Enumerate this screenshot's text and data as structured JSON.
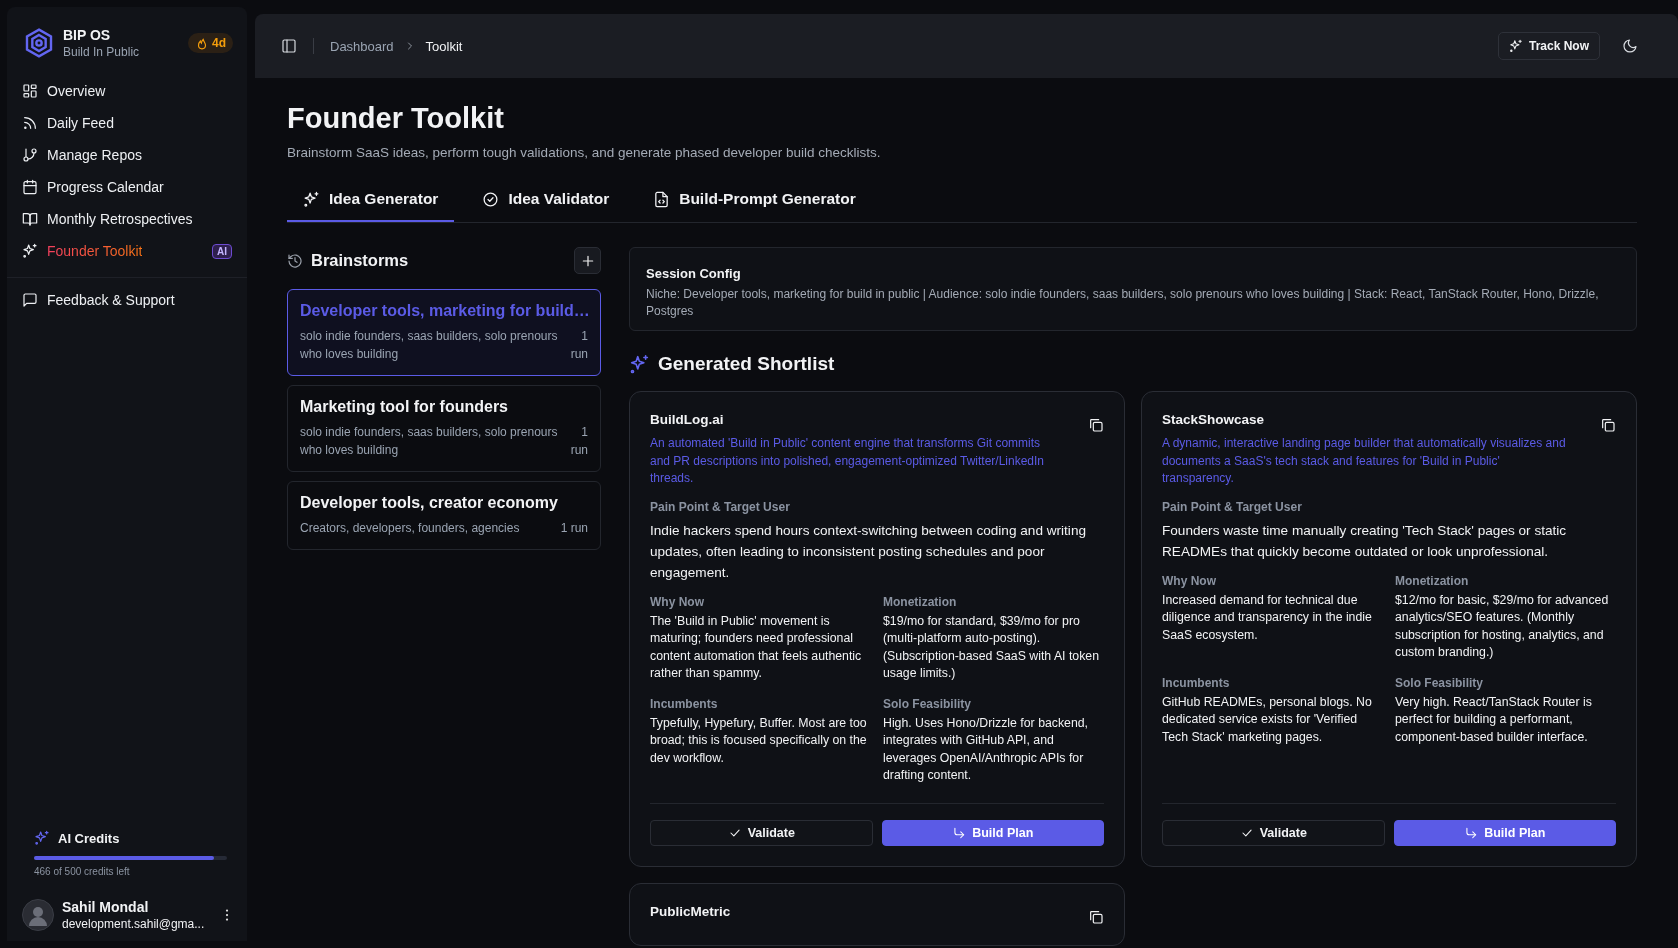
{
  "sidebar": {
    "brand": {
      "name": "BIP OS",
      "tagline": "Build In Public"
    },
    "streak": "4d",
    "nav": [
      {
        "label": "Overview",
        "selected": false
      },
      {
        "label": "Daily Feed",
        "selected": false
      },
      {
        "label": "Manage Repos",
        "selected": false
      },
      {
        "label": "Progress Calendar",
        "selected": false
      },
      {
        "label": "Monthly Retrospectives",
        "selected": false
      },
      {
        "label": "Founder Toolkit",
        "selected": true,
        "badge": "AI"
      }
    ],
    "footer_nav": [
      {
        "label": "Feedback & Support",
        "selected": false
      }
    ],
    "credits": {
      "title": "AI Credits",
      "level": 0.932,
      "caption": "466 of 500 credits left"
    },
    "user": {
      "name": "Sahil Mondal",
      "email": "development.sahil@gma..."
    }
  },
  "header": {
    "breadcrumb": [
      "Dashboard",
      "Toolkit"
    ],
    "action": "Track Now"
  },
  "page": {
    "title": "Founder Toolkit",
    "subtitle": "Brainstorm SaaS ideas, perform tough validations, and generate phased developer build checklists."
  },
  "tabs": [
    {
      "label": "Idea Generator",
      "selected": true
    },
    {
      "label": "Idea Validator",
      "selected": false
    },
    {
      "label": "Build-Prompt Generator",
      "selected": false
    }
  ],
  "brainstorms": {
    "title": "Brainstorms",
    "items": [
      {
        "title": "Developer tools, marketing for build…",
        "audience": "solo indie founders, saas builders, solo prenours who loves building",
        "runs": "1 run",
        "selected": true
      },
      {
        "title": "Marketing tool for founders",
        "audience": "solo indie founders, saas builders, solo prenours who loves building",
        "runs": "1 run",
        "selected": false
      },
      {
        "title": "Developer tools, creator economy",
        "audience": "Creators, developers, founders, agencies",
        "runs": "1 run",
        "selected": false
      }
    ]
  },
  "session_config": {
    "title": "Session Config",
    "text": "Niche: Developer tools, marketing for build in public | Audience: solo indie founders, saas builders, solo prenours who loves building | Stack: React, TanStack Router, Hono, Drizzle, Postgres"
  },
  "shortlist": {
    "title": "Generated Shortlist",
    "ideas": [
      {
        "name": "BuildLog.ai",
        "pitch": "An automated 'Build in Public' content engine that transforms Git commits and PR descriptions into polished, engagement-optimized Twitter/LinkedIn threads.",
        "pain_label": "Pain Point & Target User",
        "pain": "Indie hackers spend hours context-switching between coding and writing updates, often leading to inconsistent posting schedules and poor engagement.",
        "fields": [
          {
            "label": "Why Now",
            "text": "The 'Build in Public' movement is maturing; founders need professional content automation that feels authentic rather than spammy."
          },
          {
            "label": "Monetization",
            "text": "$19/mo for standard, $39/mo for pro (multi-platform auto-posting). (Subscription-based SaaS with AI token usage limits.)"
          },
          {
            "label": "Incumbents",
            "text": "Typefully, Hypefury, Buffer. Most are too broad; this is focused specifically on the dev workflow."
          },
          {
            "label": "Solo Feasibility",
            "text": "High. Uses Hono/Drizzle for backend, integrates with GitHub API, and leverages OpenAI/Anthropic APIs for drafting content."
          }
        ],
        "actions": [
          "Validate",
          "Build Plan"
        ]
      },
      {
        "name": "StackShowcase",
        "pitch": "A dynamic, interactive landing page builder that automatically visualizes and documents a SaaS's tech stack and features for 'Build in Public' transparency.",
        "pain_label": "Pain Point & Target User",
        "pain": "Founders waste time manually creating 'Tech Stack' pages or static READMEs that quickly become outdated or look unprofessional.",
        "fields": [
          {
            "label": "Why Now",
            "text": "Increased demand for technical due diligence and transparency in the indie SaaS ecosystem."
          },
          {
            "label": "Monetization",
            "text": "$12/mo for basic, $29/mo for advanced analytics/SEO features. (Monthly subscription for hosting, analytics, and custom branding.)"
          },
          {
            "label": "Incumbents",
            "text": "GitHub READMEs, personal blogs. No dedicated service exists for 'Verified Tech Stack' marketing pages."
          },
          {
            "label": "Solo Feasibility",
            "text": "Very high. React/TanStack Router is perfect for building a performant, component-based builder interface."
          }
        ],
        "actions": [
          "Validate",
          "Build Plan"
        ]
      },
      {
        "name": "PublicMetric"
      }
    ]
  }
}
